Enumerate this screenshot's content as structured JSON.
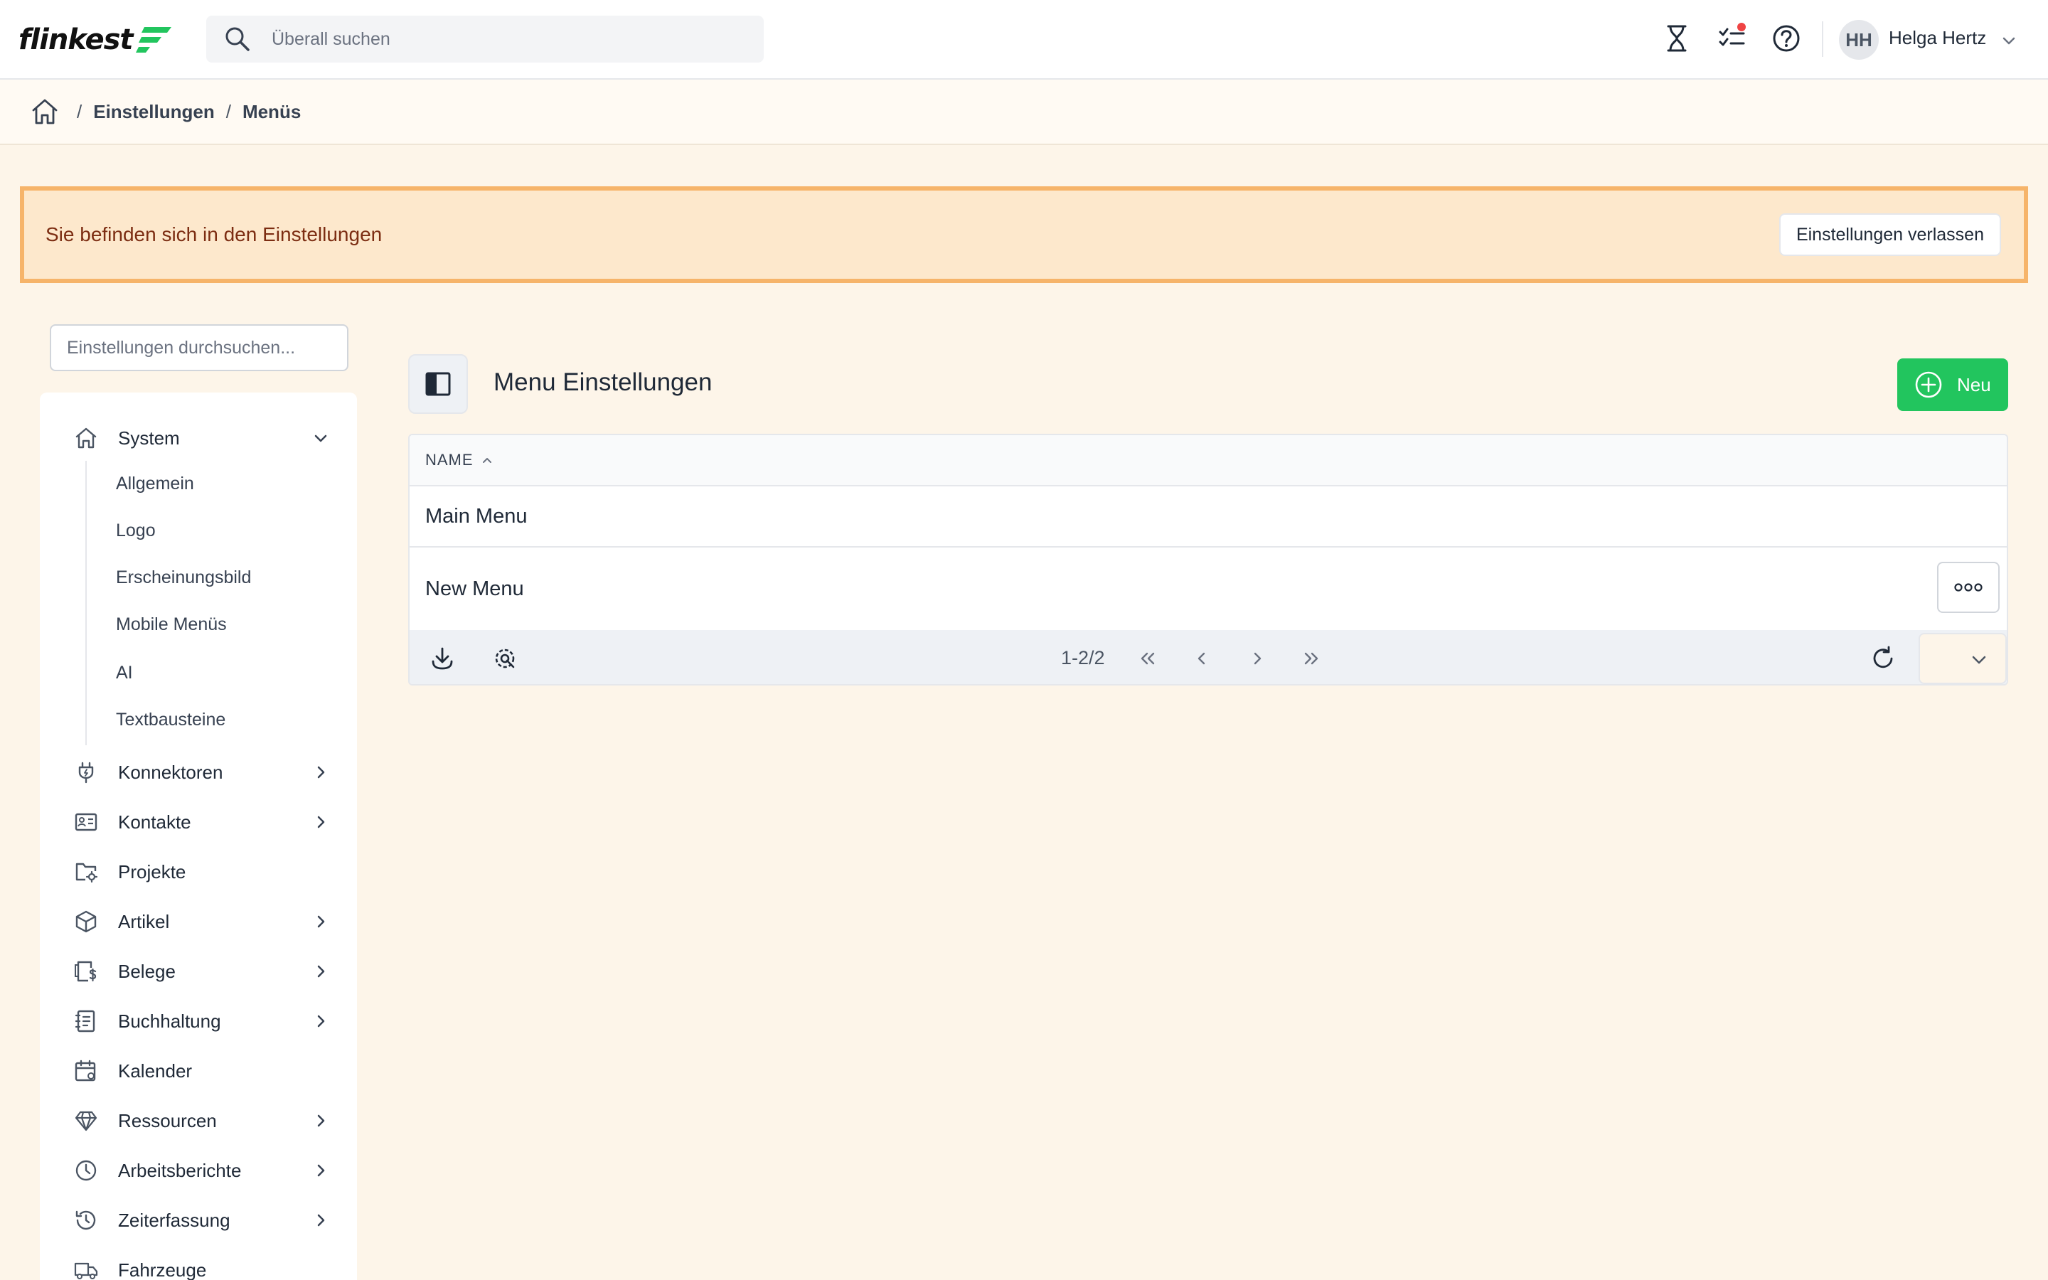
{
  "app": {
    "logo_text": "flinkest",
    "search_placeholder": "Überall suchen",
    "user_initials": "HH",
    "user_name": "Helga Hertz",
    "accent_color": "#22c55e",
    "notification_color": "#ef4444"
  },
  "top_icons": [
    "hourglass-icon",
    "tasks-icon",
    "help-icon"
  ],
  "breadcrumb": {
    "home_icon": "home-icon",
    "items": [
      "Einstellungen",
      "Menüs"
    ],
    "separator": "/"
  },
  "banner": {
    "text": "Sie befinden sich in den Einstellungen",
    "button_label": "Einstellungen verlassen"
  },
  "sidebar": {
    "search_placeholder": "Einstellungen durchsuchen...",
    "system": {
      "label": "System",
      "icon": "home-icon",
      "expanded": true,
      "children": [
        "Allgemein",
        "Logo",
        "Erscheinungsbild",
        "Mobile Menüs",
        "AI",
        "Textbausteine"
      ]
    },
    "items": [
      {
        "label": "Konnektoren",
        "icon": "plug-icon",
        "has_children": true
      },
      {
        "label": "Kontakte",
        "icon": "contact-card-icon",
        "has_children": true
      },
      {
        "label": "Projekte",
        "icon": "folder-gear-icon",
        "has_children": false
      },
      {
        "label": "Artikel",
        "icon": "box-icon",
        "has_children": true
      },
      {
        "label": "Belege",
        "icon": "receipt-icon",
        "has_children": true
      },
      {
        "label": "Buchhaltung",
        "icon": "ledger-icon",
        "has_children": true
      },
      {
        "label": "Kalender",
        "icon": "calendar-icon",
        "has_children": false
      },
      {
        "label": "Ressourcen",
        "icon": "diamond-icon",
        "has_children": true
      },
      {
        "label": "Arbeitsberichte",
        "icon": "clock-icon",
        "has_children": true
      },
      {
        "label": "Zeiterfassung",
        "icon": "history-icon",
        "has_children": true
      },
      {
        "label": "Fahrzeuge",
        "icon": "truck-icon",
        "has_children": false
      }
    ]
  },
  "main": {
    "title": "Menu Einstellungen",
    "new_button_label": "Neu",
    "table": {
      "column_header": "NAME",
      "rows": [
        "Main Menu",
        "New Menu"
      ],
      "pagination_text": "1-2/2"
    }
  }
}
